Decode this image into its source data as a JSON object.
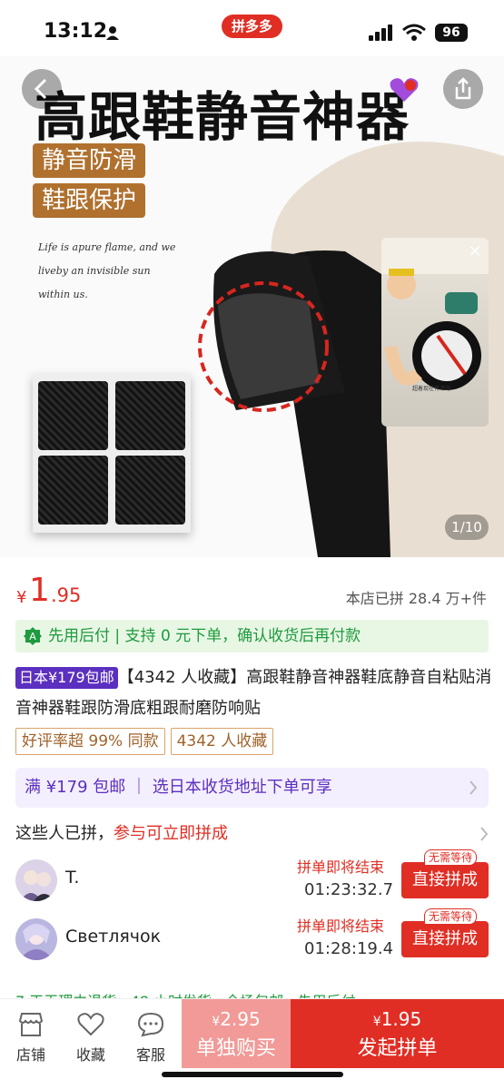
{
  "status": {
    "time": "13:12",
    "app_badge": "拼多多",
    "battery": "96"
  },
  "hero": {
    "title": "高跟鞋静音神器",
    "tags": [
      "静音防滑",
      "鞋跟保护"
    ],
    "sub_lines": [
      "Life is apure flame, and we",
      "liveby an invisible sun",
      "within us."
    ],
    "video_caption": "超着现在有活动",
    "counter": "1/10"
  },
  "price": {
    "yen": "¥",
    "int": "1",
    "dec": ".95",
    "sold": "本店已拼 28.4 万+件"
  },
  "pay_later": {
    "text": "先用后付 | 支持 0 元下单，确认收货后再付款"
  },
  "title": {
    "badge": "日本¥179包邮",
    "text": "【4342 人收藏】高跟鞋静音神器鞋底静音自粘贴消音神器鞋跟防滑底粗跟耐磨防响贴"
  },
  "review_tags": [
    "好评率超 99% 同款",
    "4342 人收藏"
  ],
  "promo": {
    "text": "满 ¥179 包邮 ｜ 选日本收货地址下单可享"
  },
  "group": {
    "head_text": "这些人已拼，",
    "head_red": "参与可立即拼成",
    "rows": [
      {
        "name": "T.",
        "ending": "拼单即将结束",
        "timer": "01:23:32.7",
        "button": "直接拼成",
        "no_wait": "无需等待"
      },
      {
        "name": "Светлячок",
        "ending": "拼单即将结束",
        "timer": "01:28:19.4",
        "button": "直接拼成",
        "no_wait": "无需等待"
      }
    ]
  },
  "service_strip": "7 天无理由退货 · 48 小时发货 · 全场包邮 · 先用后付",
  "bottom": {
    "nav": [
      {
        "label": "店铺",
        "icon": "shop-icon"
      },
      {
        "label": "收藏",
        "icon": "heart-icon"
      },
      {
        "label": "客服",
        "icon": "chat-icon"
      }
    ],
    "single": {
      "yen": "¥",
      "price": "2.95",
      "label": "单独购买"
    },
    "group": {
      "yen": "¥",
      "price": "1.95",
      "label": "发起拼单"
    }
  },
  "colors": {
    "brand_red": "#e02e24",
    "green": "#1f9a3e",
    "purple": "#5b2fbf",
    "tag_brown": "#b0712f"
  }
}
